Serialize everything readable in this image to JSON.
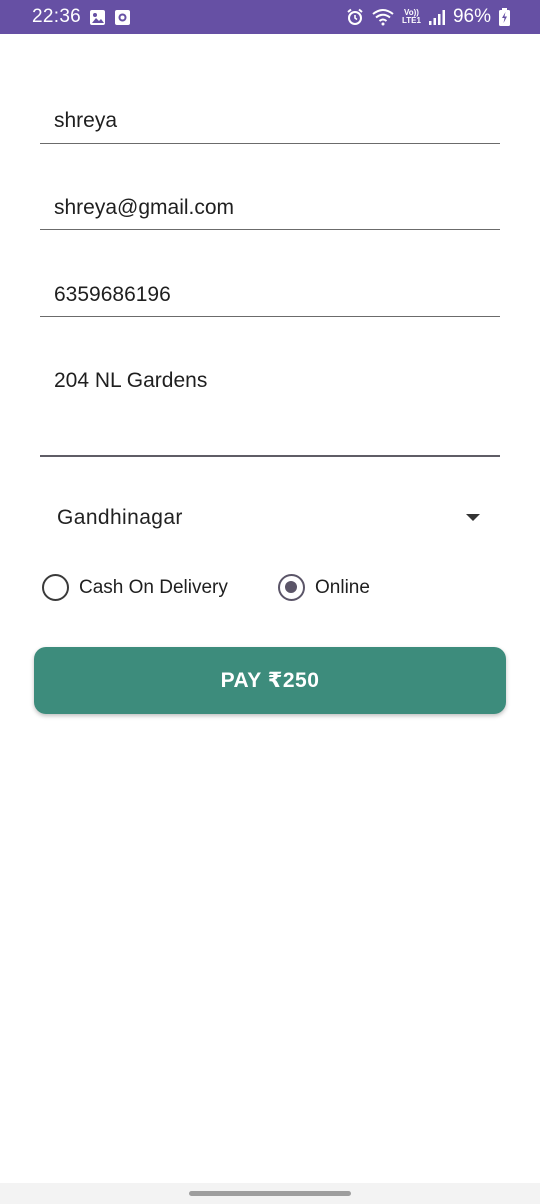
{
  "status_bar": {
    "time": "22:36",
    "battery": "96%",
    "network": "LTE1",
    "volte": "Vo))",
    "icons": [
      "gallery-icon",
      "app-notification-icon",
      "alarm-icon",
      "wifi-icon",
      "signal-icon",
      "battery-charging-icon"
    ],
    "color": "#6650a4"
  },
  "form": {
    "name_value": "shreya",
    "email_value": "shreya@gmail.com",
    "phone_value": "6359686196",
    "address_value": "204 NL Gardens",
    "city_selected": "Gandhinagar"
  },
  "payment": {
    "options": [
      "Cash On Delivery",
      "Online"
    ],
    "selected": "Online"
  },
  "pay_button": {
    "label": "PAY ₹250",
    "color": "#3d8c7c"
  }
}
